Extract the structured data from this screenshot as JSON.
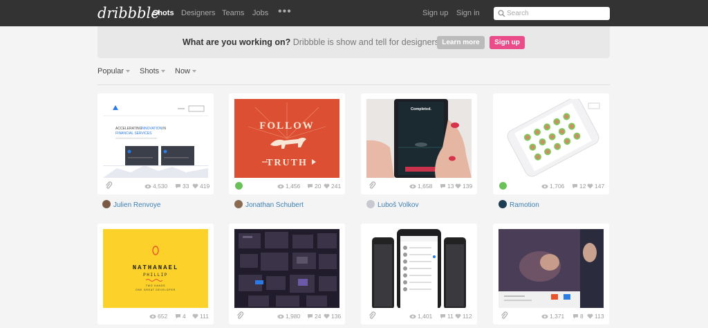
{
  "header": {
    "logo": "dribbble",
    "nav": [
      "Shots",
      "Designers",
      "Teams",
      "Jobs"
    ],
    "more": "•••",
    "sign_up": "Sign up",
    "sign_in": "Sign in",
    "search_placeholder": "Search"
  },
  "banner": {
    "question": "What are you working on?",
    "text": " Dribbble is show and tell for designers.",
    "learn_more": "Learn more",
    "sign_up": "Sign up"
  },
  "filters": [
    "Popular",
    "Shots",
    "Now"
  ],
  "shots": [
    {
      "views": "4,530",
      "comments": "33",
      "likes": "419",
      "author": "Julien Renvoye",
      "badge": "attachment"
    },
    {
      "views": "1,456",
      "comments": "20",
      "likes": "241",
      "author": "Jonathan Schubert",
      "badge": "rebound"
    },
    {
      "views": "1,658",
      "comments": "13",
      "likes": "139",
      "author": "Luboš Volkov",
      "badge": "attachment"
    },
    {
      "views": "1,706",
      "comments": "12",
      "likes": "147",
      "author": "Ramotion",
      "badge": "rebound"
    },
    {
      "views": "652",
      "comments": "4",
      "likes": "111",
      "author": "",
      "badge": "none"
    },
    {
      "views": "1,980",
      "comments": "24",
      "likes": "136",
      "author": "",
      "badge": "attachment"
    },
    {
      "views": "1,401",
      "comments": "11",
      "likes": "112",
      "author": "",
      "badge": "attachment"
    },
    {
      "views": "1,371",
      "comments": "8",
      "likes": "113",
      "author": "",
      "badge": "attachment"
    }
  ],
  "artwork": {
    "shot1_heading_a": "ACCELERATING",
    "shot1_heading_b": "INNOVATION",
    "shot1_heading_c": "IN",
    "shot1_heading_d": "FINANCIAL SERVICES",
    "shot2_top": "FOLLOW",
    "shot2_bottom": "TRUTH",
    "shot3_text": "Completed.",
    "shot5_name": "NATHANAEL",
    "shot5_sub": "PHILLIP",
    "shot5_small": "TWO HANDS",
    "shot5_small2": "ONE GREAT DEVELOPER"
  },
  "colors": {
    "brand_pink": "#ea4c89",
    "header_bg": "#333333",
    "link_blue": "#3d7fb3"
  }
}
